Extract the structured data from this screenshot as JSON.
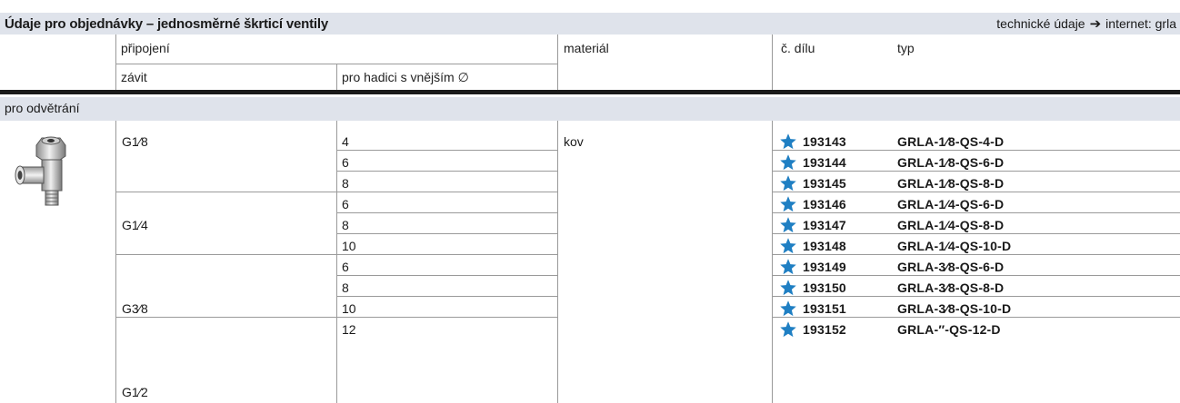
{
  "header": {
    "title": "Údaje pro objednávky – jednosměrné škrticí ventily",
    "reference_prefix": "technické údaje",
    "reference_arrow": "➔",
    "reference_suffix": "internet: grla"
  },
  "columns": {
    "connection": "připojení",
    "thread": "závit",
    "hose": "pro hadici s vnějším ∅",
    "material": "materiál",
    "part_no": "č. dílu",
    "type": "typ"
  },
  "group_label": "pro odvětrání",
  "threads": [
    "G1⁄8",
    "G1⁄4",
    "G3⁄8",
    "G1⁄2"
  ],
  "material_value": "kov",
  "rows": [
    {
      "hose": "4",
      "part_no": "193143",
      "type": "GRLA-1⁄8-QS-4-D"
    },
    {
      "hose": "6",
      "part_no": "193144",
      "type": "GRLA-1⁄8-QS-6-D"
    },
    {
      "hose": "8",
      "part_no": "193145",
      "type": "GRLA-1⁄8-QS-8-D"
    },
    {
      "hose": "6",
      "part_no": "193146",
      "type": "GRLA-1⁄4-QS-6-D"
    },
    {
      "hose": "8",
      "part_no": "193147",
      "type": "GRLA-1⁄4-QS-8-D"
    },
    {
      "hose": "10",
      "part_no": "193148",
      "type": "GRLA-1⁄4-QS-10-D"
    },
    {
      "hose": "6",
      "part_no": "193149",
      "type": "GRLA-3⁄8-QS-6-D"
    },
    {
      "hose": "8",
      "part_no": "193150",
      "type": "GRLA-3⁄8-QS-8-D"
    },
    {
      "hose": "10",
      "part_no": "193151",
      "type": "GRLA-3⁄8-QS-10-D"
    },
    {
      "hose": "12",
      "part_no": "193152",
      "type": "GRLA-″-QS-12-D"
    }
  ],
  "colors": {
    "band": "#dfe3eb",
    "star": "#1f7fc3",
    "rule": "#1a1a1a"
  },
  "icons": {
    "star": "star-icon",
    "product": "one-way-flow-control-valve-image"
  }
}
